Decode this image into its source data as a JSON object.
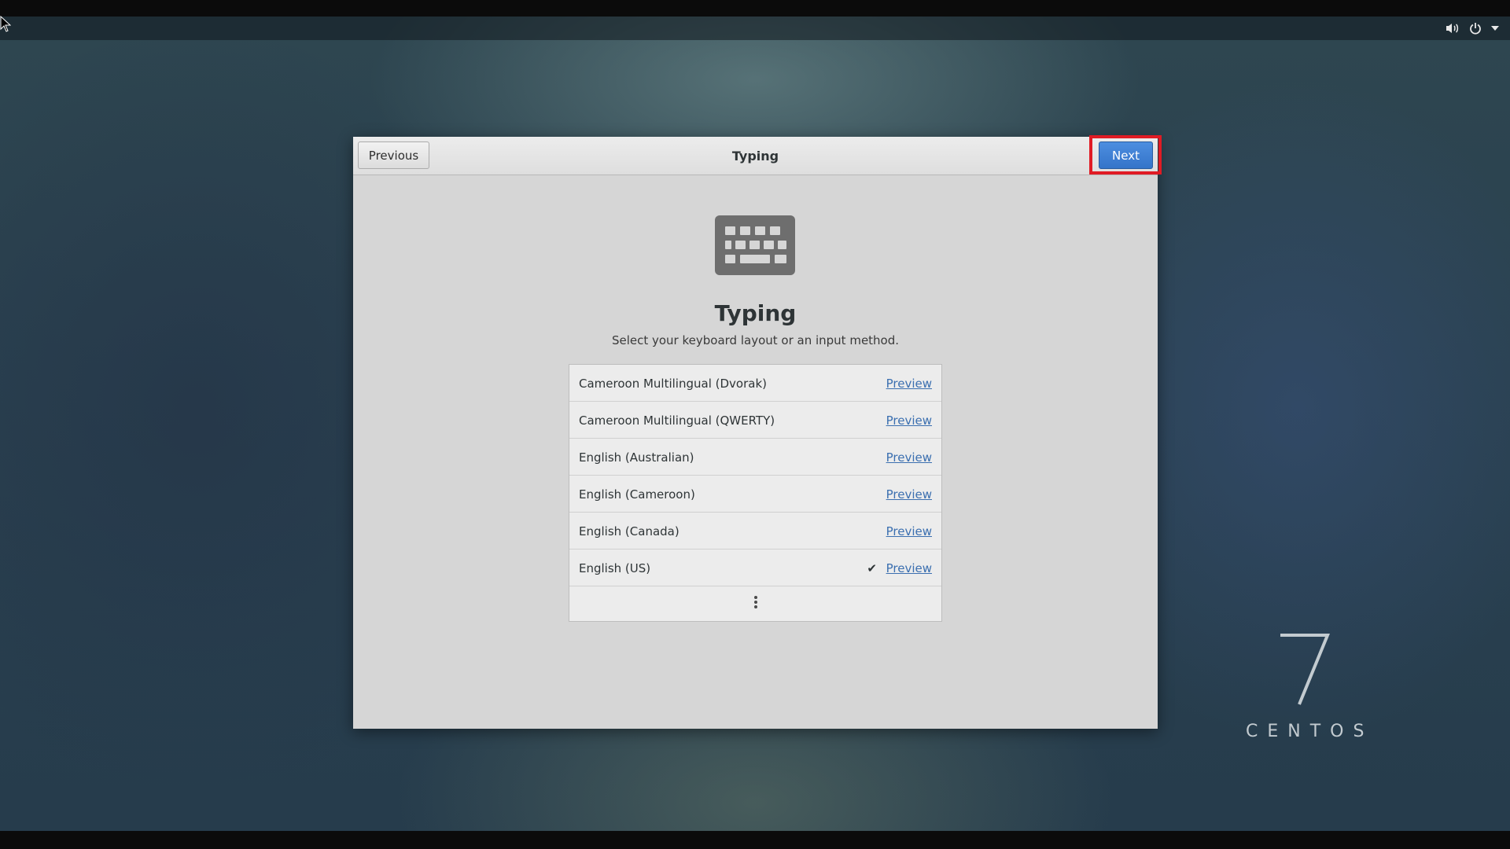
{
  "panel": {
    "icons": [
      "speaker-icon",
      "power-icon",
      "dropdown-arrow-icon"
    ]
  },
  "window": {
    "header": {
      "previous_label": "Previous",
      "title": "Typing",
      "next_label": "Next"
    },
    "page": {
      "icon": "keyboard-icon",
      "heading": "Typing",
      "subtitle": "Select your keyboard layout or an input method."
    },
    "layouts": [
      {
        "label": "Cameroon Multilingual (Dvorak)",
        "preview": "Preview",
        "selected": false
      },
      {
        "label": "Cameroon Multilingual (QWERTY)",
        "preview": "Preview",
        "selected": false
      },
      {
        "label": "English (Australian)",
        "preview": "Preview",
        "selected": false
      },
      {
        "label": "English (Cameroon)",
        "preview": "Preview",
        "selected": false
      },
      {
        "label": "English (Canada)",
        "preview": "Preview",
        "selected": false
      },
      {
        "label": "English (US)",
        "preview": "Preview",
        "selected": true,
        "check": "✔"
      }
    ],
    "more_icon": "vertical-ellipsis-icon"
  },
  "branding": {
    "version": "7",
    "name": "CENTOS"
  },
  "colors": {
    "next_button": "#3d80d8",
    "highlight": "#e01b24",
    "link": "#3b6fb0"
  }
}
